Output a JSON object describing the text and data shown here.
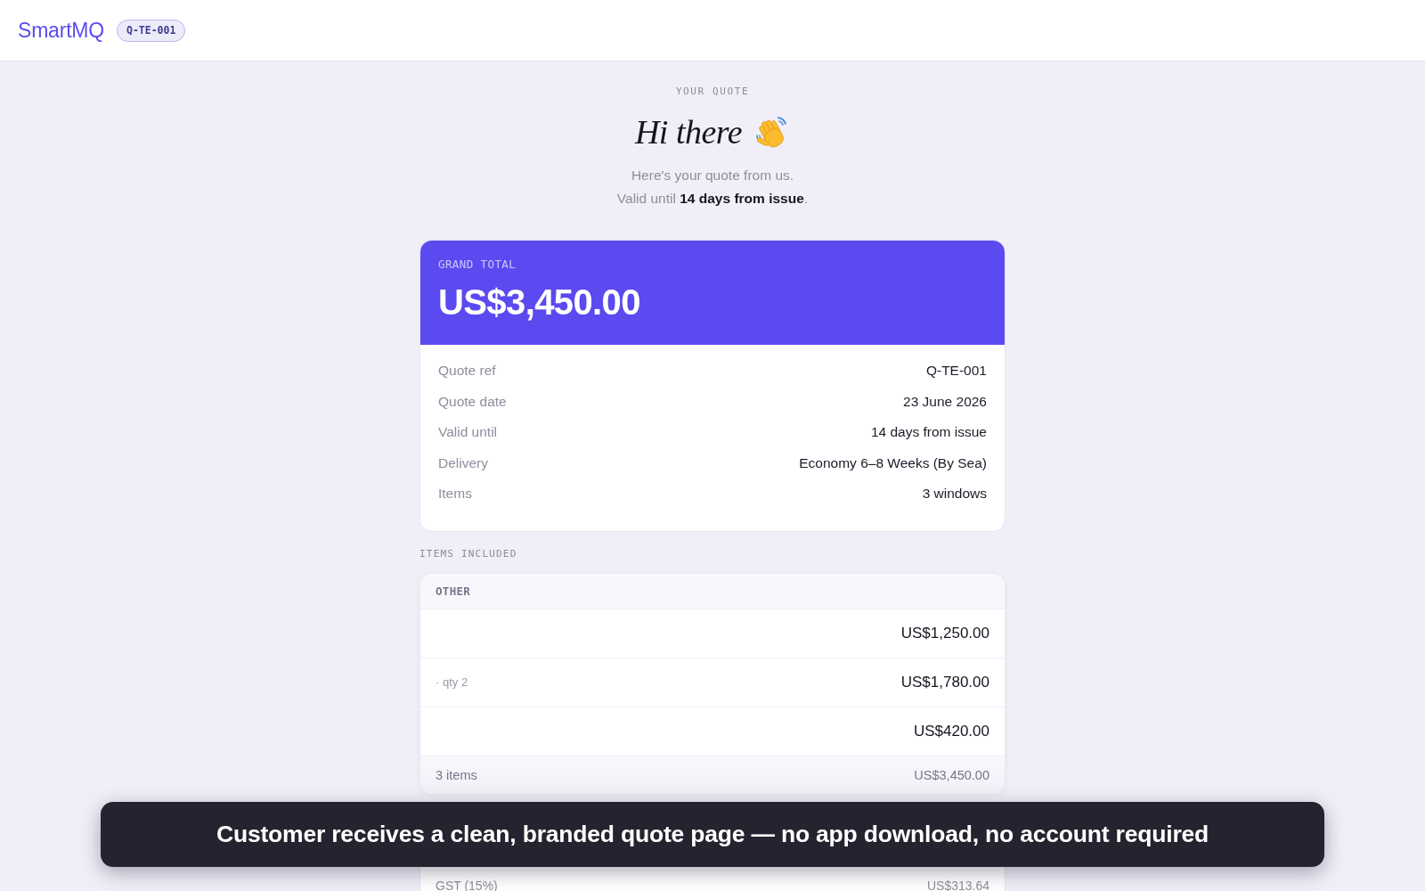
{
  "header": {
    "logo": "SmartMQ",
    "quote_badge": "Q-TE-001"
  },
  "intro": {
    "eyebrow": "YOUR QUOTE",
    "greeting": "Hi there",
    "lines": [
      "Here's your quote from us.",
      "Valid until **14 days from issue**."
    ]
  },
  "summary_card": {
    "total_label": "GRAND TOTAL",
    "total": "US$3,450.00",
    "details": [
      {
        "label": "Quote ref",
        "value": "Q-TE-001"
      },
      {
        "label": "Quote date",
        "value": "23 June 2026"
      },
      {
        "label": "Valid until",
        "value": "14 days from issue"
      },
      {
        "label": "Delivery",
        "value": "Economy 6–8 Weeks (By Sea)"
      },
      {
        "label": "Items",
        "value": "3 windows"
      }
    ]
  },
  "items_section": {
    "title": "ITEMS INCLUDED",
    "groups": [
      {
        "name": "OTHER",
        "items": [
          {
            "amount": "US$1,250.00"
          },
          {
            "note": "· qty 2",
            "amount": "US$1,780.00"
          },
          {
            "amount": "US$420.00"
          }
        ],
        "footer": {
          "count": "3 items",
          "total": "US$3,450.00"
        }
      }
    ]
  },
  "totals": [
    {
      "label": "GST (15%)",
      "value": "US$313.64"
    }
  ],
  "caption_banner": "Customer receives a clean, branded quote page — no app download, no account required"
}
